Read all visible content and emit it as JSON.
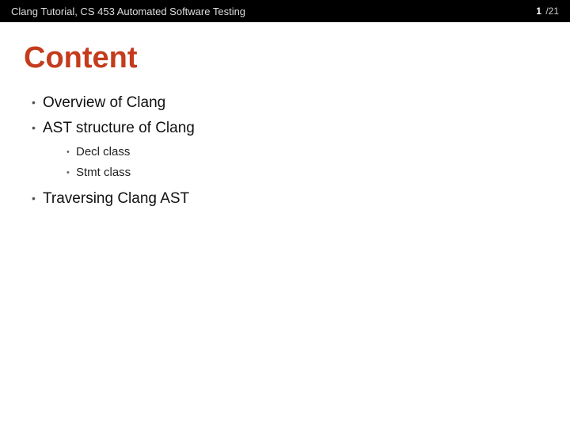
{
  "header": {
    "title": "Clang Tutorial, CS 453 Automated Software Testing",
    "page_current": "1",
    "page_total": "/21"
  },
  "slide": {
    "title": "Content",
    "bullets": [
      {
        "text": "Overview of Clang"
      },
      {
        "text": "AST structure of Clang",
        "sub": [
          {
            "text": "Decl class"
          },
          {
            "text": "Stmt class"
          }
        ]
      },
      {
        "text": "Traversing Clang AST"
      }
    ]
  }
}
